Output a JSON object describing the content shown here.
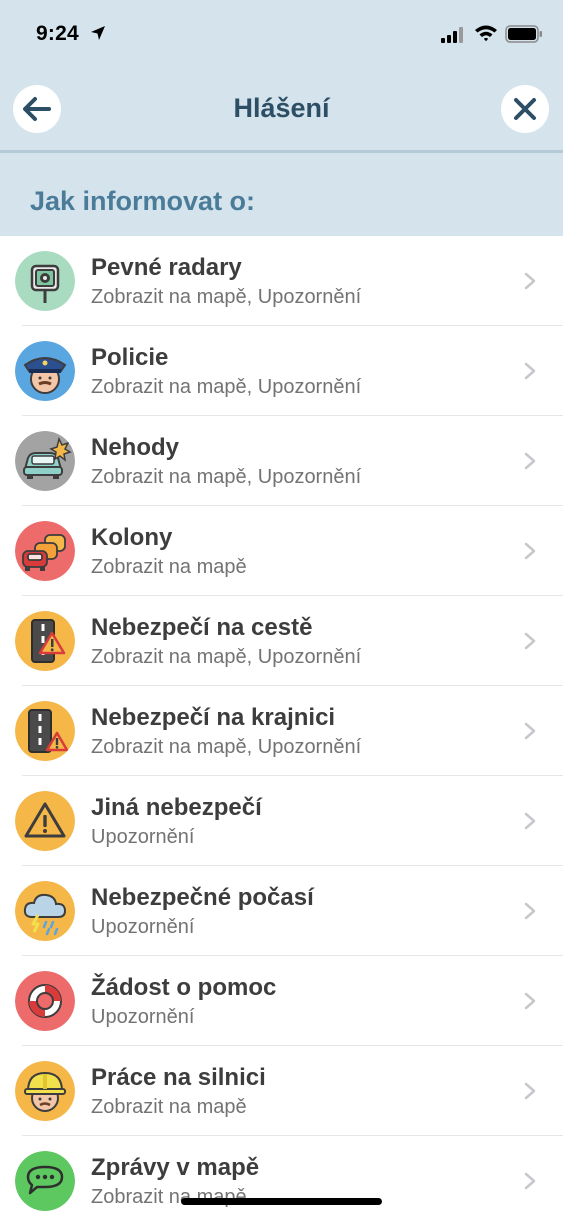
{
  "status": {
    "time": "9:24",
    "icons": [
      "location-arrow-icon",
      "cellular-signal-icon",
      "wifi-icon",
      "battery-icon"
    ]
  },
  "nav": {
    "title": "Hlášení",
    "back_icon": "arrow-left-icon",
    "close_icon": "close-icon"
  },
  "section": {
    "header": "Jak informovat o:"
  },
  "items": [
    {
      "title": "Pevné radary",
      "subtitle": "Zobrazit na mapě, Upozornění",
      "icon": "speed-camera-icon",
      "color": "#a8dbc0"
    },
    {
      "title": "Policie",
      "subtitle": "Zobrazit na mapě, Upozornění",
      "icon": "police-icon",
      "color": "#5aa6e0"
    },
    {
      "title": "Nehody",
      "subtitle": "Zobrazit na mapě, Upozornění",
      "icon": "crash-icon",
      "color": "#a3a3a3"
    },
    {
      "title": "Kolony",
      "subtitle": "Zobrazit na mapě",
      "icon": "traffic-jam-icon",
      "color": "#ee6b6b"
    },
    {
      "title": "Nebezpečí na cestě",
      "subtitle": "Zobrazit na mapě, Upozornění",
      "icon": "road-hazard-icon",
      "color": "#f4b748"
    },
    {
      "title": "Nebezpečí na krajnici",
      "subtitle": "Zobrazit na mapě, Upozornění",
      "icon": "shoulder-hazard-icon",
      "color": "#f4b748"
    },
    {
      "title": "Jiná nebezpečí",
      "subtitle": "Upozornění",
      "icon": "warning-icon",
      "color": "#f4b748"
    },
    {
      "title": "Nebezpečné počasí",
      "subtitle": "Upozornění",
      "icon": "storm-cloud-icon",
      "color": "#f4b748"
    },
    {
      "title": "Žádost o pomoc",
      "subtitle": "Upozornění",
      "icon": "lifebuoy-icon",
      "color": "#ee6b6b"
    },
    {
      "title": "Práce na silnici",
      "subtitle": "Zobrazit na mapě",
      "icon": "construction-worker-icon",
      "color": "#f4b748"
    },
    {
      "title": "Zprávy v mapě",
      "subtitle": "Zobrazit na mapě",
      "icon": "chat-bubble-icon",
      "color": "#5dc760"
    }
  ],
  "colors": {
    "header_bg": "#d5e4ec",
    "title_text": "#2c4f66",
    "section_text": "#4a7c99",
    "chevron": "#c7c7cc"
  }
}
